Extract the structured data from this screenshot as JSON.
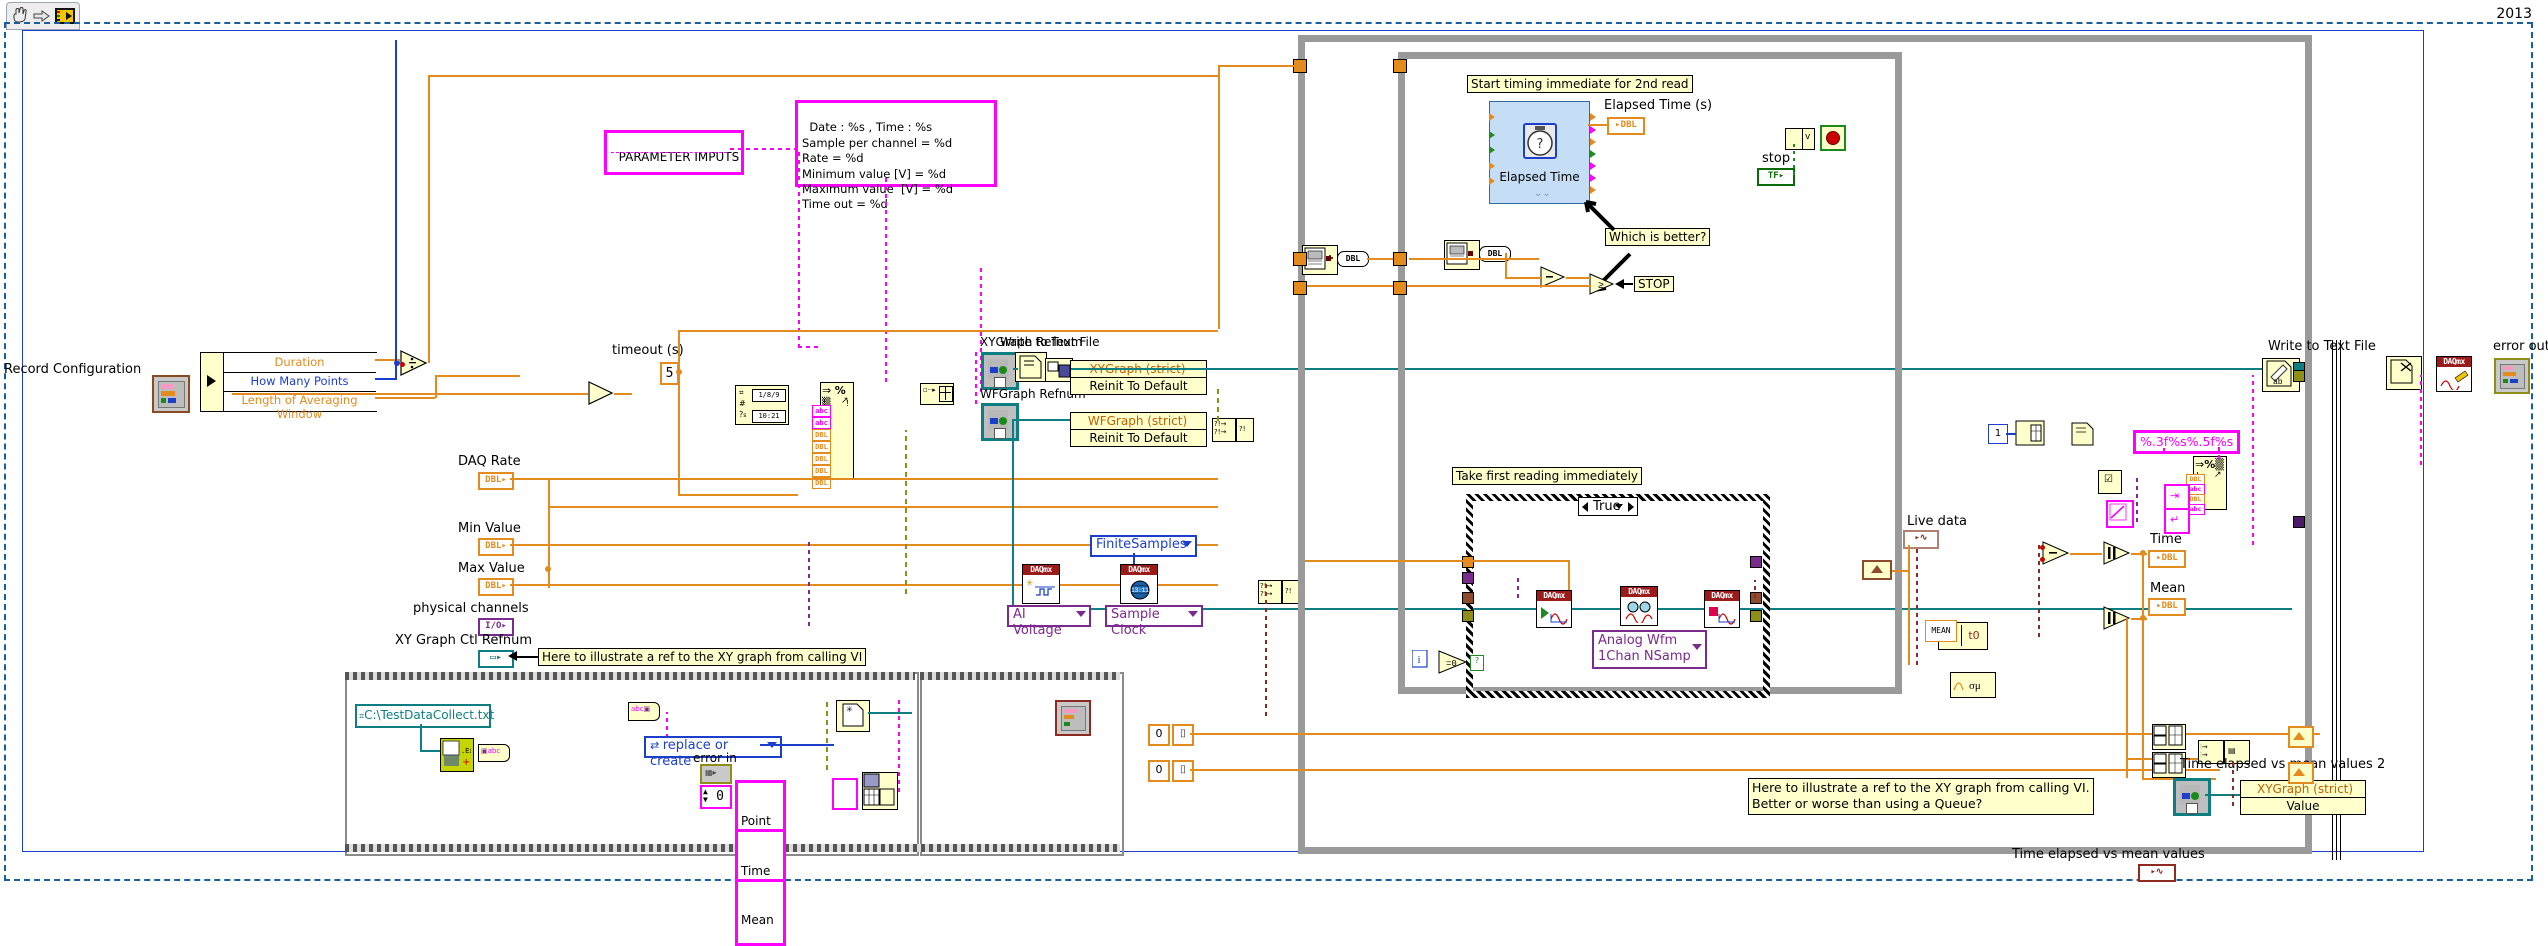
{
  "window": {
    "version_badge": "2013",
    "toolbar_icons": [
      "hand-tool-icon",
      "arrow-tool-icon",
      "vi-icon"
    ]
  },
  "comments": {
    "parameter_inputs": "PARAMETER IMPUTS",
    "format_string": "Date : %s , Time : %s\nSample per channel = %d\nRate = %d\nMinimum value [V] = %d\nMaximum value  [V] = %d\nTime out = %d",
    "start_timing": "Start timing immediate for 2nd read",
    "which_is_better": "Which is better?",
    "take_first_reading": "Take first reading immediately",
    "xy_ref_left": "Here to illustrate a ref to the XY graph from calling VI",
    "xy_ref_bottom": "Here to illustrate a ref to the XY graph from calling VI.\nBetter or worse than using a Queue?",
    "stop_label": "STOP",
    "format_small": "%.3f%s%.5f%s"
  },
  "labels": {
    "record_configuration": "Record Configuration",
    "duration": "Duration",
    "how_many_points": "How Many Points",
    "length_of_averaging_window": "Length of Averaging Window",
    "timeout": "timeout (s)",
    "timeout_value": "5",
    "daq_rate": "DAQ Rate",
    "min_value": "Min Value",
    "max_value": "Max Value",
    "physical_channels": "physical channels",
    "xy_graph_ctl_refnum": "XY Graph Ctl Refnum",
    "xygraph_refnum": "XYGraph Refnum",
    "wfgraph_refnum": "WFGraph Refnum",
    "write_to_text_file_left": "Write to Text File",
    "write_to_text_file_right": "Write to Text File",
    "elapsed_time_s": "Elapsed Time (s)",
    "elapsed_time_vi": "Elapsed Time",
    "stop": "stop",
    "live_data": "Live data",
    "time": "Time",
    "mean": "Mean",
    "error_in": "error in",
    "error_out": "error out",
    "time_elapsed_vs_mean_values": "Time elapsed vs mean values",
    "time_elapsed_vs_mean_values_2": "Time elapsed vs mean values 2",
    "file_path": "C:\\TestDataCollect.txt",
    "zero_value": "0",
    "mean_node": "MEAN",
    "t0": "t0"
  },
  "enums": {
    "finite_samples": "FiniteSamples",
    "ai_voltage": "AI Voltage",
    "sample_clock": "Sample Clock",
    "replace_or_create": "replace or create",
    "analog_wfm": "Analog Wfm\n1Chan NSamp",
    "case_true": "True"
  },
  "property_nodes": [
    {
      "target": "XYGraph (strict)",
      "property": "Reinit To Default"
    },
    {
      "target": "WFGraph (strict)",
      "property": "Reinit To Default"
    },
    {
      "target": "XYGraph (strict)",
      "property": "Value"
    }
  ],
  "cluster_items": [
    "Point",
    "Time",
    "Mean"
  ],
  "daq_nodes": [
    "DAQmx Create Channel",
    "DAQmx Timing",
    "DAQmx Start Task",
    "DAQmx Read",
    "DAQmx Stop Task",
    "DAQmx Clear Task"
  ],
  "colors": {
    "orange_wire": "#E38B1E",
    "blue_wire": "#1B3FCB",
    "pink_wire": "#FF00FF",
    "teal_wire": "#0E7E82",
    "dark_red_wire": "#8E2A1F",
    "purple_wire": "#7B2A8E",
    "olive_wire": "#8E8E18",
    "green_wire": "#1F8A1F",
    "comment_bg": "#FFFFCC",
    "structure_gray": "#9A9A9A",
    "subvi_blue": "#C5DEF5"
  }
}
